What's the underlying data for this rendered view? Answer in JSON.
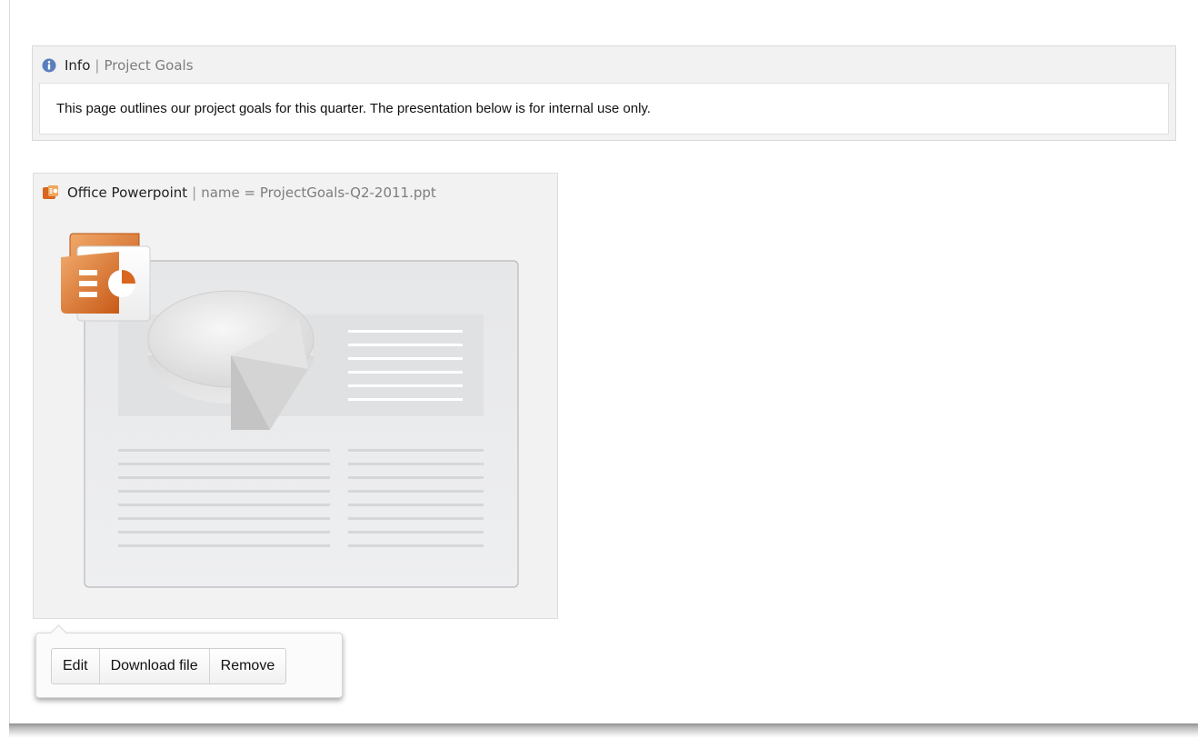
{
  "info_macro": {
    "title": "Info",
    "separator": "|",
    "param": "Project Goals",
    "body": "This page outlines our project goals for this quarter. The presentation below is for internal use only.",
    "icon": "info-circle-icon",
    "icon_color": "#5b7fbd"
  },
  "ppt_macro": {
    "title": "Office Powerpoint",
    "separator": "|",
    "param": "name = ProjectGoals-Q2-2011.ppt",
    "icon": "powerpoint-icon",
    "icon_color": "#d9661f",
    "preview": "powerpoint-placeholder"
  },
  "toolbar": {
    "edit_label": "Edit",
    "download_label": "Download file",
    "remove_label": "Remove"
  }
}
